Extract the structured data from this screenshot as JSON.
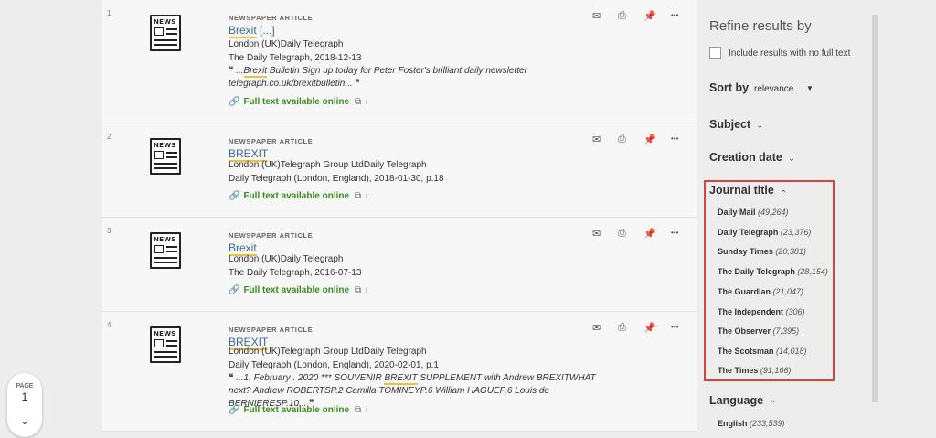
{
  "results": [
    {
      "num": "1",
      "type": "NEWSPAPER ARTICLE",
      "title_hl": "Brexit",
      "title_rest": " [...]",
      "line1": "London (UK)Daily Telegraph",
      "line2": "The Daily Telegraph, 2018-12-13",
      "snippet_pre": " ...",
      "snippet_hl": "Brexit",
      "snippet_post": " Bulletin Sign up today for Peter Foster's brilliant daily newsletter telegraph.co.uk/brexitbulletin... ",
      "fulltext": "Full text available online"
    },
    {
      "num": "2",
      "type": "NEWSPAPER ARTICLE",
      "title_hl": "BREXIT",
      "line1": "London (UK)Telegraph Group LtdDaily Telegraph",
      "line2": "Daily Telegraph (London, England), 2018-01-30, p.18",
      "fulltext": "Full text available online"
    },
    {
      "num": "3",
      "type": "NEWSPAPER ARTICLE",
      "title_hl": "Brexit",
      "line1": "London (UK)Daily Telegraph",
      "line2": "The Daily Telegraph, 2016-07-13",
      "fulltext": "Full text available online"
    },
    {
      "num": "4",
      "type": "NEWSPAPER ARTICLE",
      "title_hl": "BREXIT",
      "line1": "London (UK)Telegraph Group LtdDaily Telegraph",
      "line2": "Daily Telegraph (London, England), 2020-02-01, p.1",
      "snippet_pre": " ...1. February . 2020 *** SOUVENIR ",
      "snippet_hl": "BREXIT",
      "snippet_post": " SUPPLEMENT with Andrew BREXITWHAT next? Andrew ROBERTSP.2 Camilla TOMINEYP.6 William HAGUEP.6 Louis de BERNIERESP.10... ",
      "fulltext": "Full text available online"
    }
  ],
  "icons": {
    "news_label": "NEWS",
    "email": "✉",
    "print": "⎙",
    "pin": "📌",
    "more": "•••",
    "open_quote": "❝",
    "close_quote": "❞",
    "link": "🔗",
    "external": "⧉",
    "chevron_right": "›",
    "chevron_down": "⌄",
    "chevron_up": "⌃",
    "sort_arrow": "▼"
  },
  "sidebar": {
    "title": "Refine results by",
    "include_no_fulltext": "Include results with no full text",
    "sort_by": "Sort by",
    "sort_value": "relevance",
    "subject": "Subject",
    "creation_date": "Creation date",
    "journal_title": "Journal title",
    "journals": [
      {
        "name": "Daily Mail",
        "count": "(49,264)"
      },
      {
        "name": "Daily Telegraph",
        "count": "(23,376)"
      },
      {
        "name": "Sunday Times",
        "count": "(20,381)"
      },
      {
        "name": "The Daily Telegraph",
        "count": "(28,154)"
      },
      {
        "name": "The Guardian",
        "count": "(21,047)"
      },
      {
        "name": "The Independent",
        "count": "(306)"
      },
      {
        "name": "The Observer",
        "count": "(7,395)"
      },
      {
        "name": "The Scotsman",
        "count": "(14,018)"
      },
      {
        "name": "The Times",
        "count": "(91,166)"
      }
    ],
    "language": "Language",
    "languages": [
      {
        "name": "English",
        "count": "(233,539)"
      }
    ]
  },
  "pager": {
    "label": "PAGE",
    "number": "1"
  }
}
